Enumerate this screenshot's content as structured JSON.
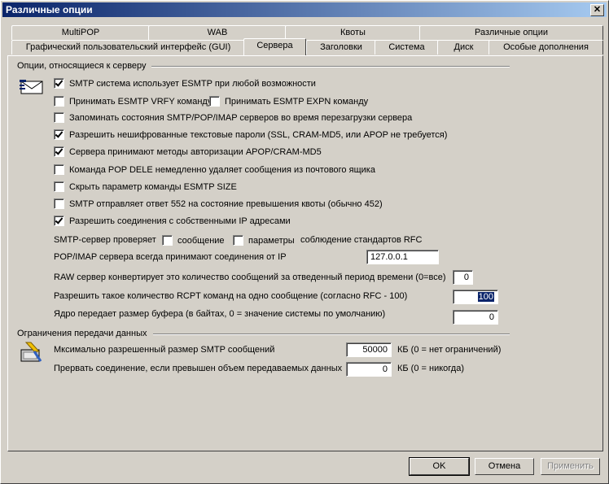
{
  "window": {
    "title": "Различные опции",
    "close_glyph": "✕"
  },
  "tabs_row1": [
    "MultiPOP",
    "WAB",
    "Квоты",
    "Различные опции"
  ],
  "tabs_row2": [
    "Графический пользовательский интерфейс (GUI)",
    "Сервера",
    "Заголовки",
    "Система",
    "Диск",
    "Особые дополнения"
  ],
  "server_group": {
    "label": "Опции, относящиеся к серверу",
    "options": [
      {
        "label": "SMTP система использует ESMTP при любой возможности",
        "checked": true
      },
      {
        "label": "Принимать ESMTP VRFY команду",
        "checked": false
      },
      {
        "label": "Принимать ESMTP EXPN команду",
        "checked": false
      },
      {
        "label": "Запоминать состояния SMTP/POP/IMAP серверов во время перезагрузки сервера",
        "checked": false
      },
      {
        "label": "Разрешить нешифрованные текстовые пароли (SSL, CRAM-MD5, или APOP не требуется)",
        "checked": true
      },
      {
        "label": "Сервера принимают методы авторизации APOP/CRAM-MD5",
        "checked": true
      },
      {
        "label": "Команда POP DELE немедленно удаляет сообщения из почтового ящика",
        "checked": false
      },
      {
        "label": "Скрыть параметр команды ESMTP SIZE",
        "checked": false
      },
      {
        "label": "SMTP отправляет ответ 552 на состояние превышения квоты (обычно 452)",
        "checked": false
      },
      {
        "label": "Разрешить соединения с собственными IP адресами",
        "checked": true
      }
    ],
    "smtp_checks_label": "SMTP-сервер проверяет",
    "check_message_label": "сообщение",
    "check_params_label": "параметры",
    "rfc_label": "соблюдение стандартов RFC",
    "pop_imap_label": "POP/IMAP сервера всегда принимают соединения от IP",
    "pop_imap_ip": "127.0.0.1",
    "raw_label": "RAW сервер конвертирует это количество сообщений за отведенный период времени (0=все)",
    "raw_value": "0",
    "rcpt_label": "Разрешить такое количество RCPT команд на одно сообщение (согласно RFC - 100)",
    "rcpt_value": "100",
    "buffer_label": "Ядро передает размер буфера (в байтах, 0 = значение системы по умолчанию)",
    "buffer_value": "0"
  },
  "transfer_group": {
    "label": "Ограничения передачи данных",
    "max_size_label": "Мксимально разрешенный размер SMTP сообщений",
    "max_size_value": "50000",
    "max_size_unit": "КБ (0 = нет ограничений)",
    "abort_label": "Прервать соединение, если превышен объем передаваемых данных",
    "abort_value": "0",
    "abort_unit": "КБ (0 = никогда)"
  },
  "buttons": {
    "ok": "OK",
    "cancel": "Отмена",
    "apply": "Применить"
  },
  "colors": {
    "titlebar_start": "#0a246a",
    "titlebar_end": "#a6caf0",
    "face": "#d4d0c8",
    "selection": "#0a246a"
  }
}
